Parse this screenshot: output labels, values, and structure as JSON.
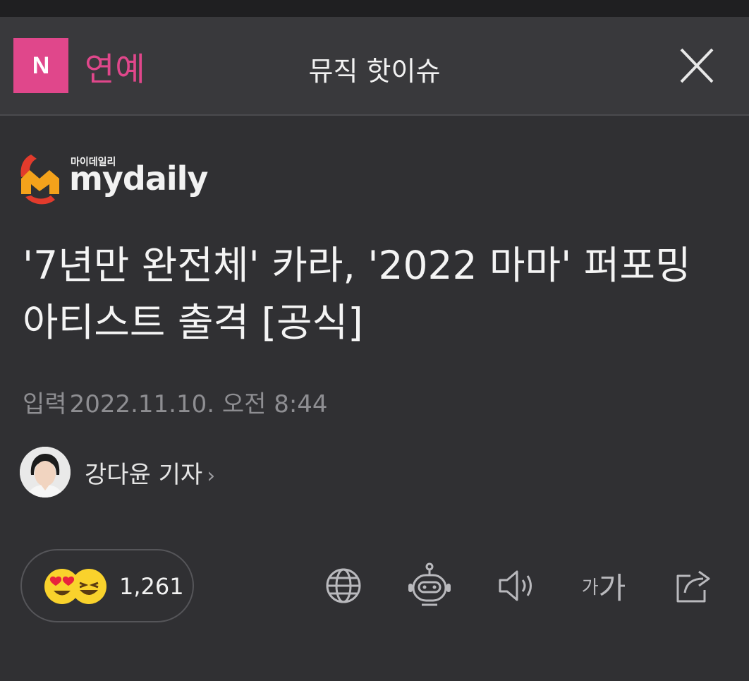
{
  "header": {
    "logo_letter": "N",
    "section": "연예",
    "title": "뮤직 핫이슈",
    "close_icon": "close-icon"
  },
  "publisher": {
    "name_korean": "마이데일리",
    "name": "mydaily"
  },
  "article": {
    "headline": "'7년만 완전체' 카라, '2022 마마' 퍼포밍 아티스트 출격 [공식]",
    "date_label": "입력",
    "date_value": "2022.11.10. 오전 8:44",
    "author": "강다윤 기자",
    "author_chevron": "›"
  },
  "reactions": {
    "count": "1,261",
    "icons": [
      "heart-eyes-emoji",
      "laughing-emoji"
    ]
  },
  "toolbar": {
    "icons": [
      "globe-icon",
      "robot-icon",
      "speaker-icon",
      "font-size-icon",
      "share-icon"
    ],
    "font_small": "가",
    "font_large": "가"
  },
  "colors": {
    "background": "#303033",
    "header_bg": "#39393c",
    "accent_pink": "#e0478b",
    "muted_text": "#8e8e92"
  }
}
